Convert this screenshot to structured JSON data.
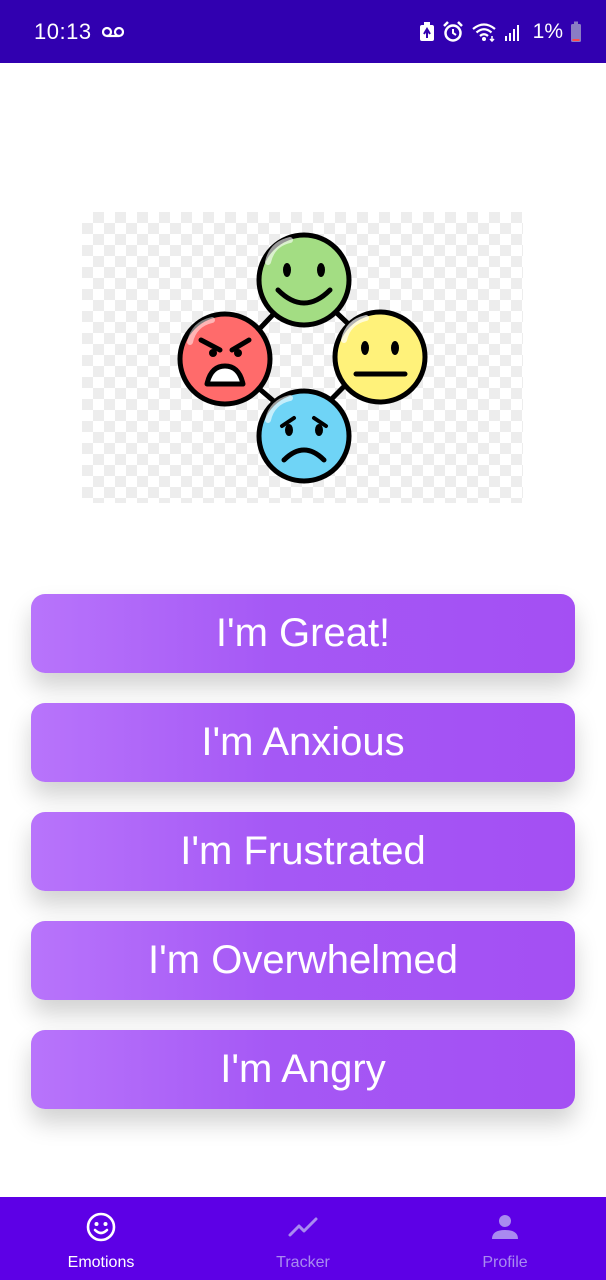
{
  "status_bar": {
    "time": "10:13",
    "battery_percent": "1%",
    "icons": [
      "voicemail-icon",
      "battery-saver-icon",
      "alarm-icon",
      "wifi-icon",
      "signal-icon",
      "battery-icon"
    ],
    "background_color": "#3100b0"
  },
  "hero": {
    "icon": "emotions-cycle-illustration",
    "faces": [
      "happy-face",
      "neutral-face",
      "sad-face",
      "angry-face"
    ],
    "colors": {
      "happy": "#a3dd83",
      "neutral": "#fff27a",
      "sad": "#6fd4f6",
      "angry": "#ff6b6b",
      "outline": "#000000"
    }
  },
  "emotions": [
    {
      "label": "I'm Great!"
    },
    {
      "label": "I'm Anxious"
    },
    {
      "label": "I'm Frustrated"
    },
    {
      "label": "I'm Overwhelmed"
    },
    {
      "label": "I'm Angry"
    }
  ],
  "button_gradient": [
    "#b874fb",
    "#a558f5",
    "#a44ff3"
  ],
  "bottom_nav": {
    "background_color": "#5d00e6",
    "items": [
      {
        "label": "Emotions",
        "icon": "smiley-icon",
        "active": true
      },
      {
        "label": "Tracker",
        "icon": "trend-line-icon",
        "active": false
      },
      {
        "label": "Profile",
        "icon": "person-icon",
        "active": false
      }
    ]
  }
}
